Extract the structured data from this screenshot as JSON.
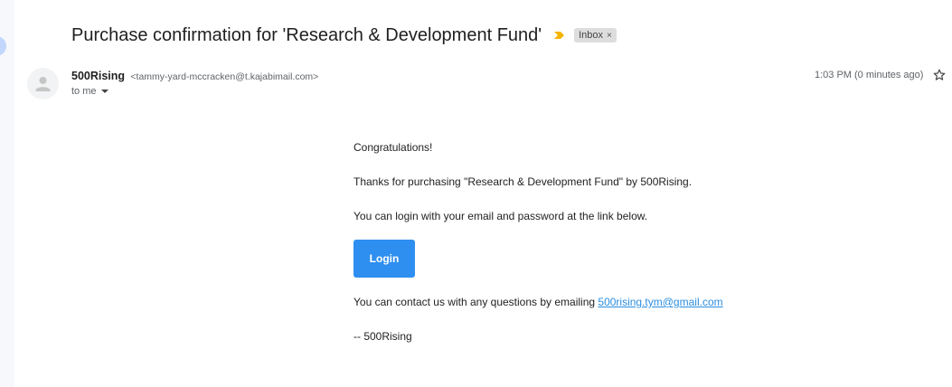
{
  "email": {
    "subject": "Purchase confirmation for 'Research & Development Fund'",
    "label": "Inbox",
    "label_close": "×",
    "sender_name": "500Rising",
    "sender_email": "<tammy-yard-mccracken@t.kajabimail.com>",
    "recipient": "to me",
    "time": "1:03 PM (0 minutes ago)"
  },
  "message": {
    "greeting": "Congratulations!",
    "thanks": "Thanks for purchasing \"Research & Development Fund\" by 500Rising.",
    "login_info": "You can login with your email and password at the link below.",
    "login_button": "Login",
    "contact_prefix": "You can contact us with any questions by emailing ",
    "contact_email": "500rising.tym@gmail.com",
    "signature": "-- 500Rising"
  },
  "icons": {
    "importance": "importance-marker-icon",
    "avatar": "person-avatar-icon",
    "star": "star-outline-icon",
    "caret": "chevron-down-icon"
  },
  "colors": {
    "login_button": "#2f8ff0",
    "link": "#2b8ee0",
    "importance": "#f4b400"
  }
}
